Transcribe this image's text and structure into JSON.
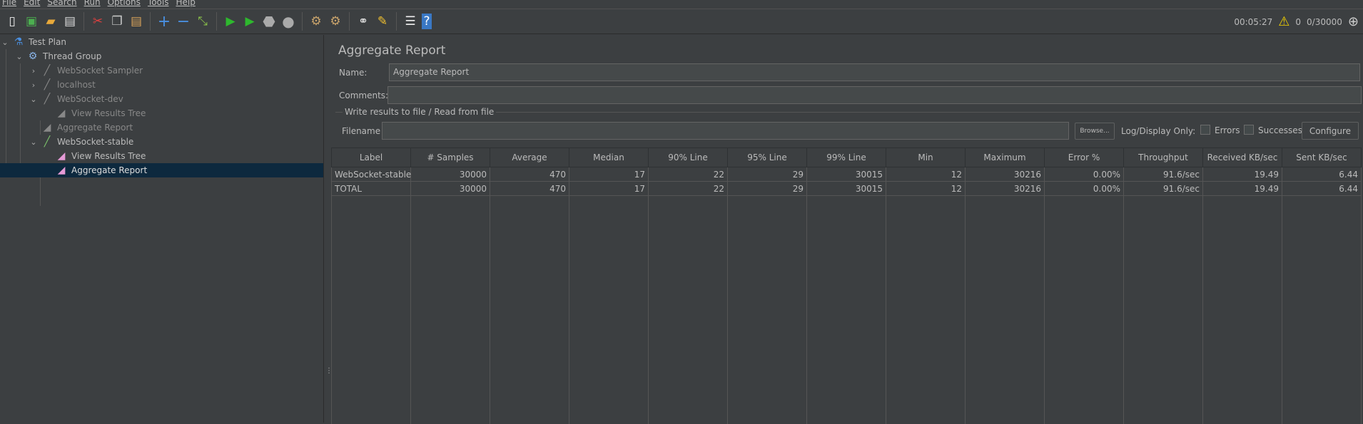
{
  "menu": [
    "File",
    "Edit",
    "Search",
    "Run",
    "Options",
    "Tools",
    "Help"
  ],
  "toolbar_icons": [
    "new-icon",
    "templates-icon",
    "open-icon",
    "save-icon",
    "cut-icon",
    "copy-icon",
    "paste-icon",
    "expand-icon",
    "collapse-icon",
    "toggle-icon",
    "start-icon",
    "start-no-pause-icon",
    "stop-icon",
    "shutdown-icon",
    "clear-icon",
    "clear-all-icon",
    "search-icon",
    "reset-search-icon",
    "function-helper-icon",
    "help-icon"
  ],
  "status": {
    "elapsed": "00:05:27",
    "warnings": "0",
    "threads": "0/30000"
  },
  "tree": [
    {
      "label": "Test Plan",
      "icon": "flask-icon"
    },
    {
      "label": "Thread Group",
      "icon": "gear-icon"
    },
    {
      "label": "WebSocket Sampler",
      "icon": "pipette-icon"
    },
    {
      "label": "localhost",
      "icon": "pipette-icon"
    },
    {
      "label": "WebSocket-dev",
      "icon": "pipette-icon"
    },
    {
      "label": "View Results Tree",
      "icon": "listener-icon"
    },
    {
      "label": "Aggregate Report",
      "icon": "listener-icon"
    },
    {
      "label": "WebSocket-stable",
      "icon": "pipette-icon"
    },
    {
      "label": "View Results Tree",
      "icon": "listener-icon"
    },
    {
      "label": "Aggregate Report",
      "icon": "listener-icon"
    }
  ],
  "panel": {
    "title": "Aggregate Report",
    "name_label": "Name:",
    "name_value": "Aggregate Report",
    "comments_label": "Comments:",
    "comments_value": "",
    "group_title": "Write results to file / Read from file",
    "filename_label": "Filename",
    "filename_value": "",
    "browse": "Browse...",
    "log_display": "Log/Display Only:",
    "errors": "Errors",
    "successes": "Successes",
    "configure": "Configure"
  },
  "table": {
    "headers": [
      "Label",
      "# Samples",
      "Average",
      "Median",
      "90% Line",
      "95% Line",
      "99% Line",
      "Min",
      "Maximum",
      "Error %",
      "Throughput",
      "Received KB/sec",
      "Sent KB/sec"
    ],
    "rows": [
      [
        "WebSocket-stable",
        "30000",
        "470",
        "17",
        "22",
        "29",
        "30015",
        "12",
        "30216",
        "0.00%",
        "91.6/sec",
        "19.49",
        "6.44"
      ],
      [
        "TOTAL",
        "30000",
        "470",
        "17",
        "22",
        "29",
        "30015",
        "12",
        "30216",
        "0.00%",
        "91.6/sec",
        "19.49",
        "6.44"
      ]
    ]
  }
}
